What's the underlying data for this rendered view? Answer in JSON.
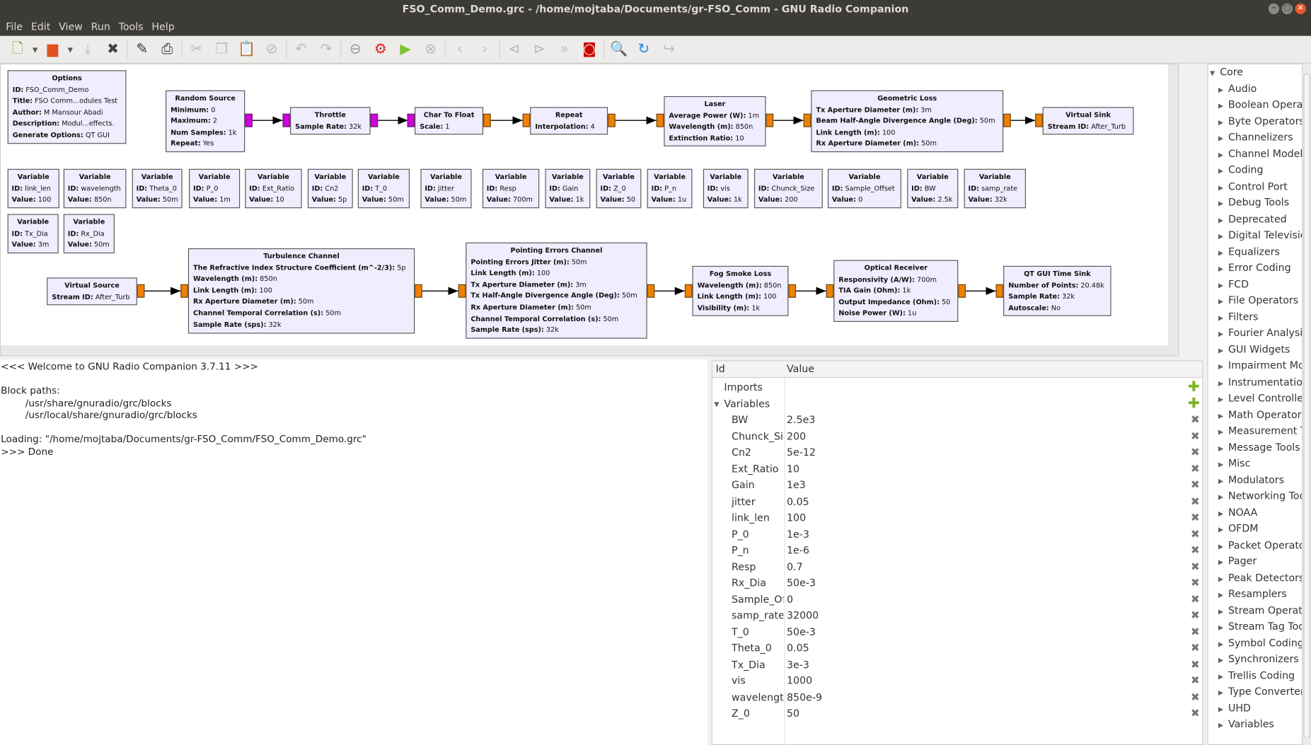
{
  "window": {
    "title": "FSO_Comm_Demo.grc - /home/mojtaba/Documents/gr-FSO_Comm - GNU Radio Companion"
  },
  "menu": [
    "File",
    "Edit",
    "View",
    "Run",
    "Tools",
    "Help"
  ],
  "toolbar": [
    "new-icon",
    "open-icon",
    "save-icon",
    "close-icon",
    "properties-icon",
    "print-icon",
    "cut-icon",
    "copy-icon",
    "paste-icon",
    "disable-icon",
    "undo-icon",
    "redo-icon",
    "remove-icon",
    "generate-icon",
    "run-icon",
    "stop-icon",
    "back-icon",
    "forward-icon",
    "rotate-ccw-icon",
    "rotate-cw-icon",
    "bypass-icon",
    "kill-icon",
    "find-icon",
    "reload-icon",
    "redo-arrow-icon"
  ],
  "colors": {
    "block_bg": "#f0edff",
    "port_stream": "#f08000",
    "port_byte": "#d000e0"
  },
  "blocks": [
    {
      "title": "Options",
      "params": [
        [
          "ID:",
          "FSO_Comm_Demo"
        ],
        [
          "Title:",
          "FSO Comm...odules Test"
        ],
        [
          "Author:",
          "M Mansour Abadi"
        ],
        [
          "Description:",
          "Modul...effects."
        ],
        [
          "Generate Options:",
          "QT GUI"
        ]
      ]
    },
    {
      "title": "Random Source",
      "params": [
        [
          "Minimum:",
          "0"
        ],
        [
          "Maximum:",
          "2"
        ],
        [
          "Num Samples:",
          "1k"
        ],
        [
          "Repeat:",
          "Yes"
        ]
      ],
      "left": true
    },
    {
      "title": "Throttle",
      "params": [
        [
          "Sample Rate:",
          "32k"
        ]
      ]
    },
    {
      "title": "Char To Float",
      "params": [
        [
          "Scale:",
          "1"
        ]
      ]
    },
    {
      "title": "Repeat",
      "params": [
        [
          "Interpolation:",
          "4"
        ]
      ]
    },
    {
      "title": "Laser",
      "params": [
        [
          "Average Power (W):",
          "1m"
        ],
        [
          "Wavelength (m):",
          "850n"
        ],
        [
          "Extinction Ratio:",
          "10"
        ]
      ]
    },
    {
      "title": "Geometric Loss",
      "params": [
        [
          "Tx Aperture Diameter (m):",
          "3m"
        ],
        [
          "Beam Half-Angle Divergence Angle (Deg):",
          "50m"
        ],
        [
          "Link Length (m):",
          "100"
        ],
        [
          "Rx Aperture Diameter (m):",
          "50m"
        ]
      ]
    },
    {
      "title": "Virtual Sink",
      "params": [
        [
          "Stream ID:",
          "After_Turb"
        ]
      ]
    },
    {
      "title": "Virtual Source",
      "params": [
        [
          "Stream ID:",
          "After_Turb"
        ]
      ]
    },
    {
      "title": "Turbulence Channel",
      "params": [
        [
          "The Refractive Index Structure Coefficient (m^-2/3):",
          "5p"
        ],
        [
          "Wavelength (m):",
          "850n"
        ],
        [
          "Link Length (m):",
          "100"
        ],
        [
          "Rx Aperture Diameter (m):",
          "50m"
        ],
        [
          "Channel Temporal Correlation (s):",
          "50m"
        ],
        [
          "Sample Rate (sps):",
          "32k"
        ]
      ]
    },
    {
      "title": "Pointing Errors Channel",
      "params": [
        [
          "Pointing Errors Jitter (m):",
          "50m"
        ],
        [
          "Link Length (m):",
          "100"
        ],
        [
          "Tx Aperture Diameter (m):",
          "3m"
        ],
        [
          "Tx Half-Angle Divergence Angle (Deg):",
          "50m"
        ],
        [
          "Rx Aperture Diameter (m):",
          "50m"
        ],
        [
          "Channel Temporal Correlation (s):",
          "50m"
        ],
        [
          "Sample Rate (sps):",
          "32k"
        ]
      ]
    },
    {
      "title": "Fog Smoke Loss",
      "params": [
        [
          "Wavelength (m):",
          "850n"
        ],
        [
          "Link Length (m):",
          "100"
        ],
        [
          "Visibility (m):",
          "1k"
        ]
      ]
    },
    {
      "title": "Optical Receiver",
      "params": [
        [
          "Responsivity (A/W):",
          "700m"
        ],
        [
          "TIA Gain (Ohm):",
          "1k"
        ],
        [
          "Output Impedance (Ohm):",
          "50"
        ],
        [
          "Noise Power (W):",
          "1u"
        ]
      ]
    },
    {
      "title": "QT GUI Time Sink",
      "params": [
        [
          "Number of Points:",
          "20.48k"
        ],
        [
          "Sample Rate:",
          "32k"
        ],
        [
          "Autoscale:",
          "No"
        ]
      ]
    }
  ],
  "variable_blocks": [
    [
      "link_len",
      "100"
    ],
    [
      "wavelength",
      "850n"
    ],
    [
      "Theta_0",
      "50m"
    ],
    [
      "P_0",
      "1m"
    ],
    [
      "Ext_Ratio",
      "10"
    ],
    [
      "Cn2",
      "5p"
    ],
    [
      "T_0",
      "50m"
    ],
    [
      "jitter",
      "50m"
    ],
    [
      "Resp",
      "700m"
    ],
    [
      "Gain",
      "1k"
    ],
    [
      "Z_0",
      "50"
    ],
    [
      "P_n",
      "1u"
    ],
    [
      "vis",
      "1k"
    ],
    [
      "Chunck_Size",
      "200"
    ],
    [
      "Sample_Offset",
      "0"
    ],
    [
      "BW",
      "2.5k"
    ],
    [
      "samp_rate",
      "32k"
    ],
    [
      "Tx_Dia",
      "3m"
    ],
    [
      "Rx_Dia",
      "50m"
    ]
  ],
  "variable_block_labels": {
    "title": "Variable",
    "id": "ID:",
    "value": "Value:"
  },
  "console": {
    "lines": [
      "<<< Welcome to GNU Radio Companion 3.7.11 >>>",
      "",
      "Block paths:",
      "\t/usr/share/gnuradio/grc/blocks",
      "\t/usr/local/share/gnuradio/grc/blocks",
      "",
      "Loading: \"/home/mojtaba/Documents/gr-FSO_Comm/FSO_Comm_Demo.grc\"",
      ">>> Done"
    ]
  },
  "variables_panel": {
    "col_id": "Id",
    "col_value": "Value",
    "imports": "Imports",
    "variables": "Variables",
    "rows": [
      [
        "BW",
        "2.5e3"
      ],
      [
        "Chunck_Size",
        "200"
      ],
      [
        "Cn2",
        "5e-12"
      ],
      [
        "Ext_Ratio",
        "10"
      ],
      [
        "Gain",
        "1e3"
      ],
      [
        "jitter",
        "0.05"
      ],
      [
        "link_len",
        "100"
      ],
      [
        "P_0",
        "1e-3"
      ],
      [
        "P_n",
        "1e-6"
      ],
      [
        "Resp",
        "0.7"
      ],
      [
        "Rx_Dia",
        "50e-3"
      ],
      [
        "Sample_Offset",
        "0"
      ],
      [
        "samp_rate",
        "32000"
      ],
      [
        "T_0",
        "50e-3"
      ],
      [
        "Theta_0",
        "0.05"
      ],
      [
        "Tx_Dia",
        "3e-3"
      ],
      [
        "vis",
        "1000"
      ],
      [
        "wavelength",
        "850e-9"
      ],
      [
        "Z_0",
        "50"
      ]
    ]
  },
  "block_tree": {
    "root": "Core",
    "items": [
      "Audio",
      "Boolean Operators",
      "Byte Operators",
      "Channelizers",
      "Channel Models",
      "Coding",
      "Control Port",
      "Debug Tools",
      "Deprecated",
      "Digital Television",
      "Equalizers",
      "Error Coding",
      "FCD",
      "File Operators",
      "Filters",
      "Fourier Analysis",
      "GUI Widgets",
      "Impairment Models",
      "Instrumentation",
      "Level Controllers",
      "Math Operators",
      "Measurement Tools",
      "Message Tools",
      "Misc",
      "Modulators",
      "Networking Tools",
      "NOAA",
      "OFDM",
      "Packet Operators",
      "Pager",
      "Peak Detectors",
      "Resamplers",
      "Stream Operators",
      "Stream Tag Tools",
      "Symbol Coding",
      "Synchronizers",
      "Trellis Coding",
      "Type Converters",
      "UHD",
      "Variables"
    ]
  }
}
